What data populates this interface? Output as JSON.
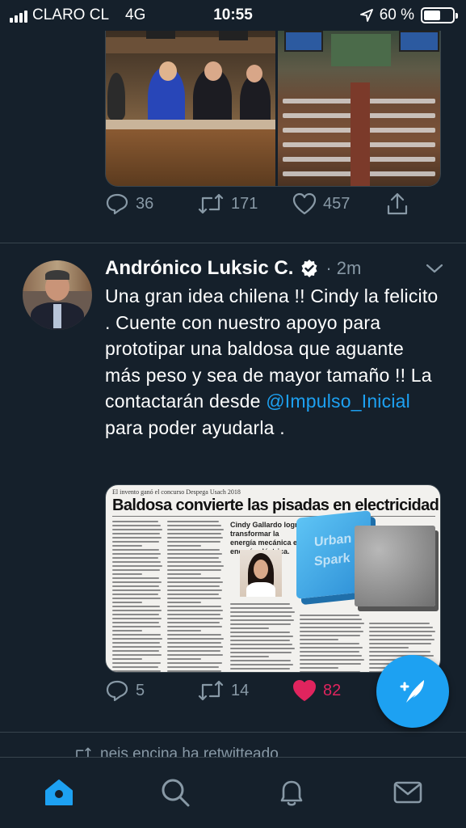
{
  "status_bar": {
    "carrier": "CLARO CL",
    "network": "4G",
    "time": "10:55",
    "battery": "60 %",
    "battery_level": 0.6
  },
  "tweet1": {
    "replies": "36",
    "retweets": "171",
    "likes": "457"
  },
  "tweet2": {
    "author": "Andrónico Luksic C.",
    "verified": true,
    "time": "· 2m",
    "text_before": "Una gran idea chilena !! Cindy la felicito .  Cuente con nuestro apoyo para prototipar una baldosa que aguante más peso y sea de mayor tamaño !!  La contactarán desde ",
    "mention": "@Impulso_Inicial",
    "text_after": " para poder ayudarla .",
    "newspaper": {
      "kicker": "El invento ganó el concurso Despega Usach 2018",
      "headline": "Baldosa convierte las pisadas en electricidad",
      "quote": "Cindy Gallardo logró transformar la energía mecánica en energía eléctrica.",
      "tile_text": [
        "Urban",
        "Spark"
      ]
    },
    "replies": "5",
    "retweets": "14",
    "likes": "82",
    "liked": true
  },
  "next_tweet": {
    "retweeted_by": "neis encina ha retwitteado"
  },
  "colors": {
    "background": "#15202b",
    "accent": "#1da1f2",
    "muted": "#8899a6",
    "like": "#e0245e"
  },
  "icons": [
    "reply-icon",
    "retweet-icon",
    "like-icon",
    "share-icon",
    "more-chevron-icon",
    "verified-badge-icon",
    "compose-icon",
    "home-icon",
    "search-icon",
    "notifications-icon",
    "messages-icon"
  ]
}
